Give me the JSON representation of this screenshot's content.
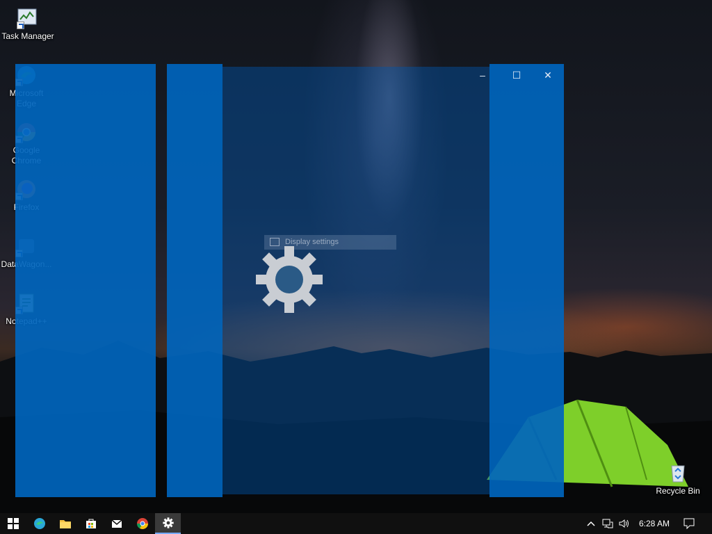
{
  "desktop": {
    "icons": [
      {
        "label": "Task Manager",
        "icon": "task-manager-icon"
      },
      {
        "label": "Microsoft Edge",
        "icon": "edge-icon"
      },
      {
        "label": "Google Chrome",
        "icon": "chrome-icon"
      },
      {
        "label": "Firefox",
        "icon": "firefox-icon"
      },
      {
        "label": "DataWagon...",
        "icon": "datawagon-icon"
      },
      {
        "label": "Notepad++",
        "icon": "notepadpp-icon"
      },
      {
        "label": "Recycle Bin",
        "icon": "recycle-bin-icon"
      }
    ]
  },
  "settings_window": {
    "caption": {
      "minimize": "–",
      "maximize": "☐",
      "close": "✕"
    },
    "search_suggestion": "Display settings",
    "splash_icon": "gear-icon"
  },
  "taskbar": {
    "apps": [
      {
        "name": "Start",
        "icon": "windows-logo-icon"
      },
      {
        "name": "Microsoft Edge",
        "icon": "edge-icon"
      },
      {
        "name": "File Explorer",
        "icon": "folder-icon"
      },
      {
        "name": "Microsoft Store",
        "icon": "store-icon"
      },
      {
        "name": "Mail",
        "icon": "mail-icon"
      },
      {
        "name": "Google Chrome",
        "icon": "chrome-icon"
      },
      {
        "name": "Settings",
        "icon": "gear-icon",
        "active": true
      }
    ],
    "tray": {
      "clock": "6:28 AM"
    }
  },
  "colors": {
    "snap_overlay": "#0065bd",
    "taskbar": "#101010",
    "active_indicator": "#77aaff"
  }
}
